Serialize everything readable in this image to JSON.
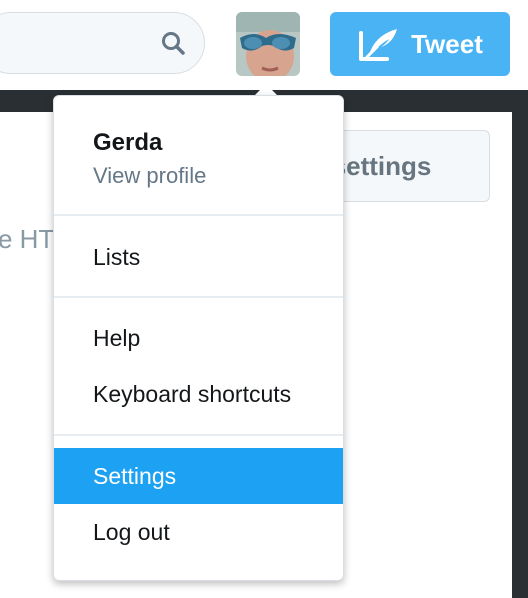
{
  "header": {
    "search_placeholder": "",
    "tweet_label": "Tweet"
  },
  "background": {
    "back_button_label": "Back to widget settings",
    "partial_text": "e HTML of your page"
  },
  "menu": {
    "profile_name": "Gerda",
    "profile_link": "View profile",
    "items": [
      {
        "label": "Lists"
      },
      {
        "label": "Help"
      },
      {
        "label": "Keyboard shortcuts"
      },
      {
        "label": "Settings",
        "active": true
      },
      {
        "label": "Log out"
      }
    ]
  },
  "colors": {
    "accent": "#1da1f2",
    "tweet_button": "#4ab3f4",
    "dark_band": "#292f33"
  },
  "icons": [
    "search-icon",
    "quill-icon",
    "avatar-image"
  ]
}
